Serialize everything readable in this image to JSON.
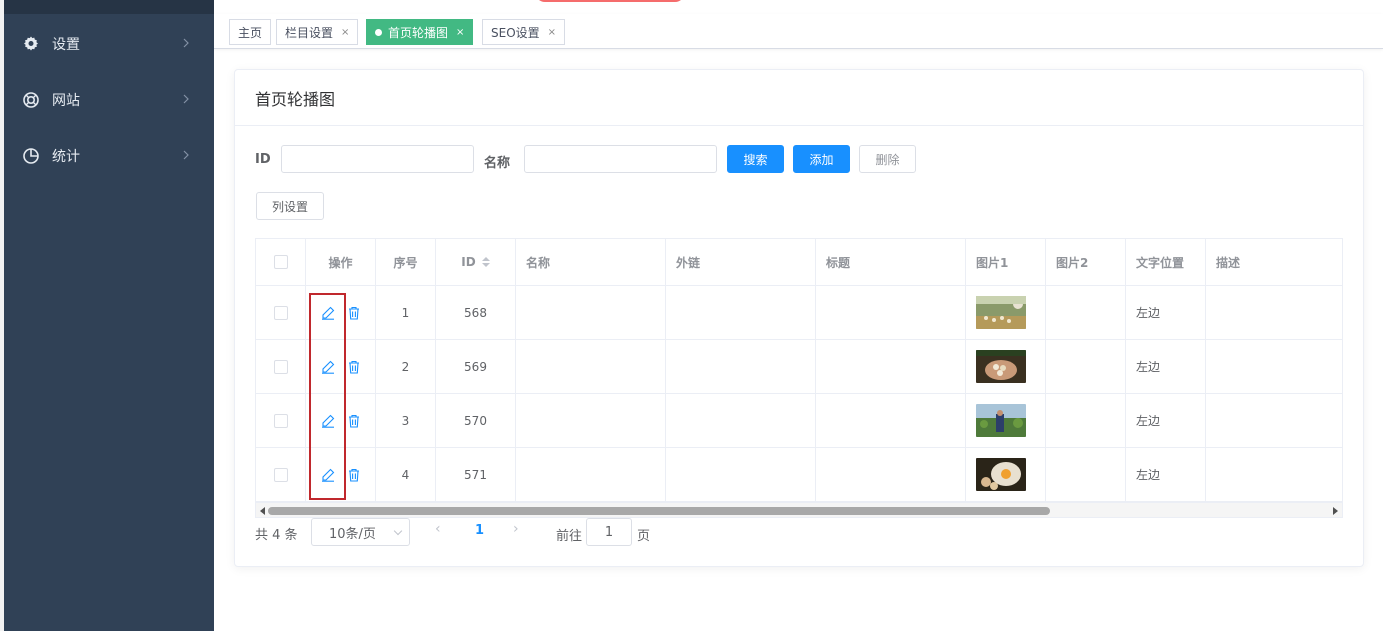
{
  "sidebar": {
    "items": [
      {
        "label": "设置",
        "icon": "gear-icon"
      },
      {
        "label": "网站",
        "icon": "lifebuoy-icon"
      },
      {
        "label": "统计",
        "icon": "pie-chart-icon"
      }
    ]
  },
  "tags": [
    {
      "label": "主页",
      "closable": false
    },
    {
      "label": "栏目设置",
      "closable": true,
      "close": "×"
    },
    {
      "label": "首页轮播图",
      "closable": true,
      "close": "×",
      "active": true
    },
    {
      "label": "SEO设置",
      "closable": true,
      "close": "×"
    }
  ],
  "card": {
    "title": "首页轮播图"
  },
  "filters": {
    "id_label": "ID",
    "name_label": "名称",
    "id_value": "",
    "name_value": "",
    "search_btn": "搜索",
    "add_btn": "添加",
    "delete_btn": "删除",
    "columns_btn": "列设置"
  },
  "table": {
    "headers": [
      "操作",
      "序号",
      "ID",
      "名称",
      "外链",
      "标题",
      "图片1",
      "图片2",
      "文字位置",
      "描述"
    ],
    "rows": [
      {
        "index": "1",
        "id": "568",
        "name": "",
        "link": "",
        "title": "",
        "image1": "farm-chickens",
        "image2": "",
        "text_pos": "左边",
        "desc": ""
      },
      {
        "index": "2",
        "id": "569",
        "name": "",
        "link": "",
        "title": "",
        "image1": "hands-eggs",
        "image2": "",
        "text_pos": "左边",
        "desc": ""
      },
      {
        "index": "3",
        "id": "570",
        "name": "",
        "link": "",
        "title": "",
        "image1": "farmer-field",
        "image2": "",
        "text_pos": "左边",
        "desc": ""
      },
      {
        "index": "4",
        "id": "571",
        "name": "",
        "link": "",
        "title": "",
        "image1": "egg-bowl",
        "image2": "",
        "text_pos": "左边",
        "desc": ""
      }
    ]
  },
  "pagination": {
    "total": "共 4 条",
    "page_size": "10条/页",
    "prev": "‹",
    "next": "›",
    "current": "1",
    "goto_label": "前往",
    "goto_value": "1",
    "page_label": "页"
  },
  "colors": {
    "sidebar_bg": "#304156",
    "active_tag": "#42b983",
    "primary": "#1890ff",
    "highlight_box": "#c0282d"
  }
}
